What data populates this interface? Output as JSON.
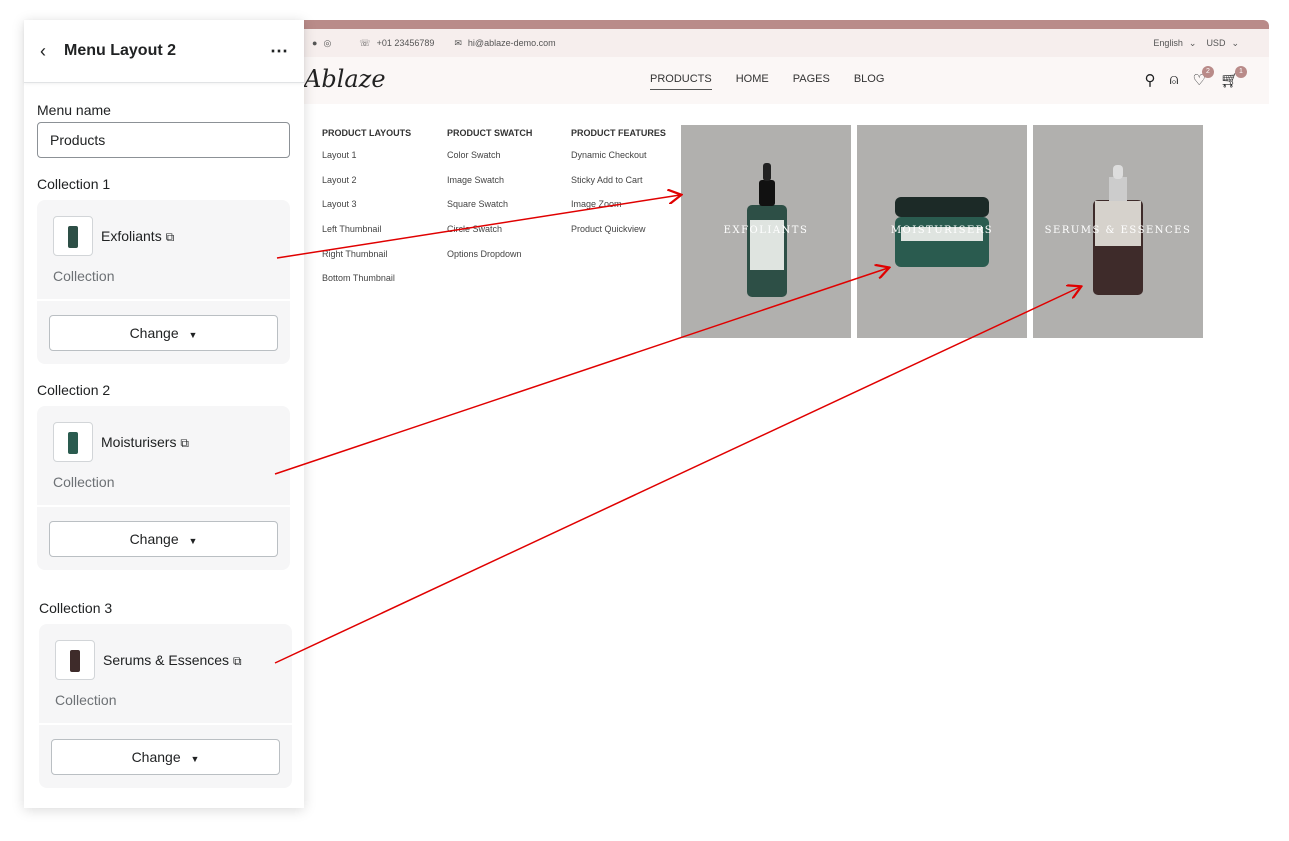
{
  "panel": {
    "title": "Menu Layout 2",
    "menu_name_label": "Menu name",
    "menu_name_value": "Products",
    "collections": [
      {
        "label": "Collection 1",
        "name": "Exfoliants",
        "type": "Collection",
        "button": "Change"
      },
      {
        "label": "Collection 2",
        "name": "Moisturisers",
        "type": "Collection",
        "button": "Change"
      },
      {
        "label": "Collection 3",
        "name": "Serums & Essences",
        "type": "Collection",
        "button": "Change"
      }
    ]
  },
  "store": {
    "phone": "+01 23456789",
    "email": "hi@ablaze-demo.com",
    "language": "English",
    "currency": "USD",
    "logo": "Ablaze",
    "nav": [
      "PRODUCTS",
      "HOME",
      "PAGES",
      "BLOG"
    ],
    "wishlist_count": "2",
    "cart_count": "1",
    "columns": [
      {
        "heading": "PRODUCT LAYOUTS",
        "items": [
          "Layout 1",
          "Layout 2",
          "Layout 3",
          "Left Thumbnail",
          "Right Thumbnail",
          "Bottom Thumbnail"
        ]
      },
      {
        "heading": "PRODUCT SWATCH",
        "items": [
          "Color Swatch",
          "Image Swatch",
          "Square Swatch",
          "Circle Swatch",
          "Options Dropdown"
        ]
      },
      {
        "heading": "PRODUCT FEATURES",
        "items": [
          "Dynamic Checkout",
          "Sticky Add to Cart",
          "Image Zoom",
          "Product Quickview"
        ]
      }
    ],
    "tiles": [
      "EXFOLIANTS",
      "MOISTURISERS",
      "SERUMS & ESSENCES"
    ]
  },
  "colors": {
    "accent": "#b98b89",
    "arrow": "#e00000"
  }
}
